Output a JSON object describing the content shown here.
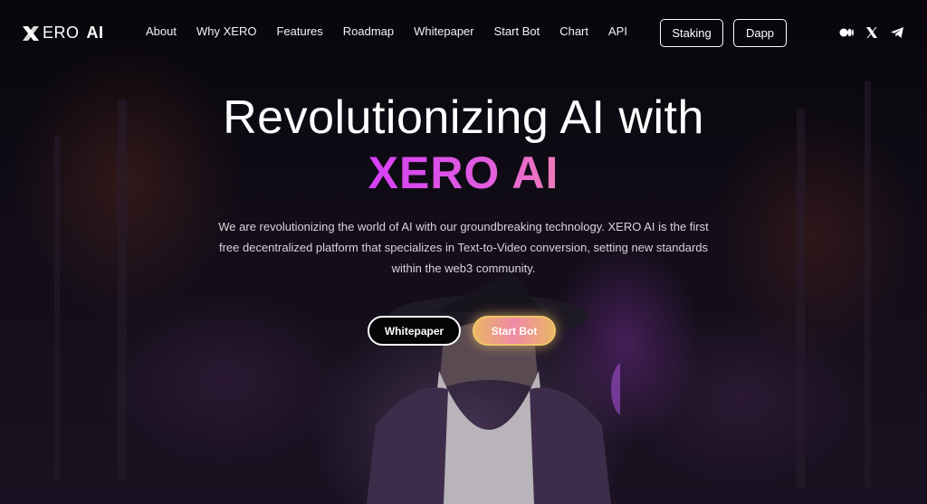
{
  "brand": {
    "name_prefix": "ERO",
    "name_suffix": "AI",
    "logo_icon": "x-logo-icon"
  },
  "nav": {
    "items": [
      {
        "label": "About"
      },
      {
        "label": "Why XERO"
      },
      {
        "label": "Features"
      },
      {
        "label": "Roadmap"
      },
      {
        "label": "Whitepaper"
      },
      {
        "label": "Start Bot"
      },
      {
        "label": "Chart"
      },
      {
        "label": "API"
      }
    ],
    "staking_label": "Staking",
    "dapp_label": "Dapp",
    "socials": [
      "medium-icon",
      "x-twitter-icon",
      "telegram-icon"
    ]
  },
  "hero": {
    "title_line1": "Revolutionizing AI with",
    "title_line2": "XERO AI",
    "description": "We are revolutionizing the world of AI with our groundbreaking technology. XERO AI is the first free decentralized platform that specializes in Text-to-Video conversion, setting new standards within the web3 community.",
    "whitepaper_label": "Whitepaper",
    "startbot_label": "Start Bot"
  },
  "colors": {
    "accent_gradient_start": "#d63ff5",
    "accent_gradient_end": "#f07ab8",
    "startbot_gold": "#e9b565",
    "background": "#0a0810"
  }
}
